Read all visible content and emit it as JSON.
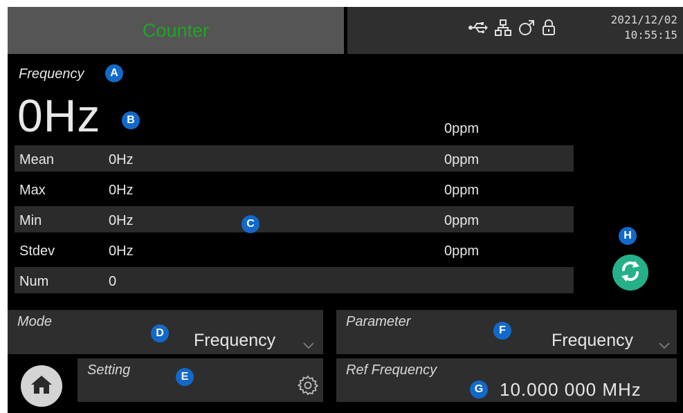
{
  "header": {
    "title": "Counter",
    "date": "2021/12/02",
    "time": "10:55:15",
    "icons": [
      "usb-icon",
      "network-icon",
      "external-ref-icon",
      "lock-icon"
    ]
  },
  "frequency": {
    "label": "Frequency",
    "value": "0Hz",
    "ppm": "0ppm"
  },
  "stats": [
    {
      "label": "Mean",
      "value": "0Hz",
      "ppm": "0ppm"
    },
    {
      "label": "Max",
      "value": "0Hz",
      "ppm": "0ppm"
    },
    {
      "label": "Min",
      "value": "0Hz",
      "ppm": "0ppm"
    },
    {
      "label": "Stdev",
      "value": "0Hz",
      "ppm": "0ppm"
    },
    {
      "label": "Num",
      "value": "0",
      "ppm": ""
    }
  ],
  "mode": {
    "label": "Mode",
    "value": "Frequency"
  },
  "parameter": {
    "label": "Parameter",
    "value": "Frequency"
  },
  "setting": {
    "label": "Setting"
  },
  "ref_frequency": {
    "label": "Ref Frequency",
    "value": "10.000 000 MHz"
  },
  "callouts": {
    "a": "A",
    "b": "B",
    "c": "C",
    "d": "D",
    "e": "E",
    "f": "F",
    "g": "G",
    "h": "H"
  },
  "colors": {
    "title_green": "#1fa526",
    "callout_blue": "#1269c9",
    "refresh_teal": "#25b08a"
  }
}
